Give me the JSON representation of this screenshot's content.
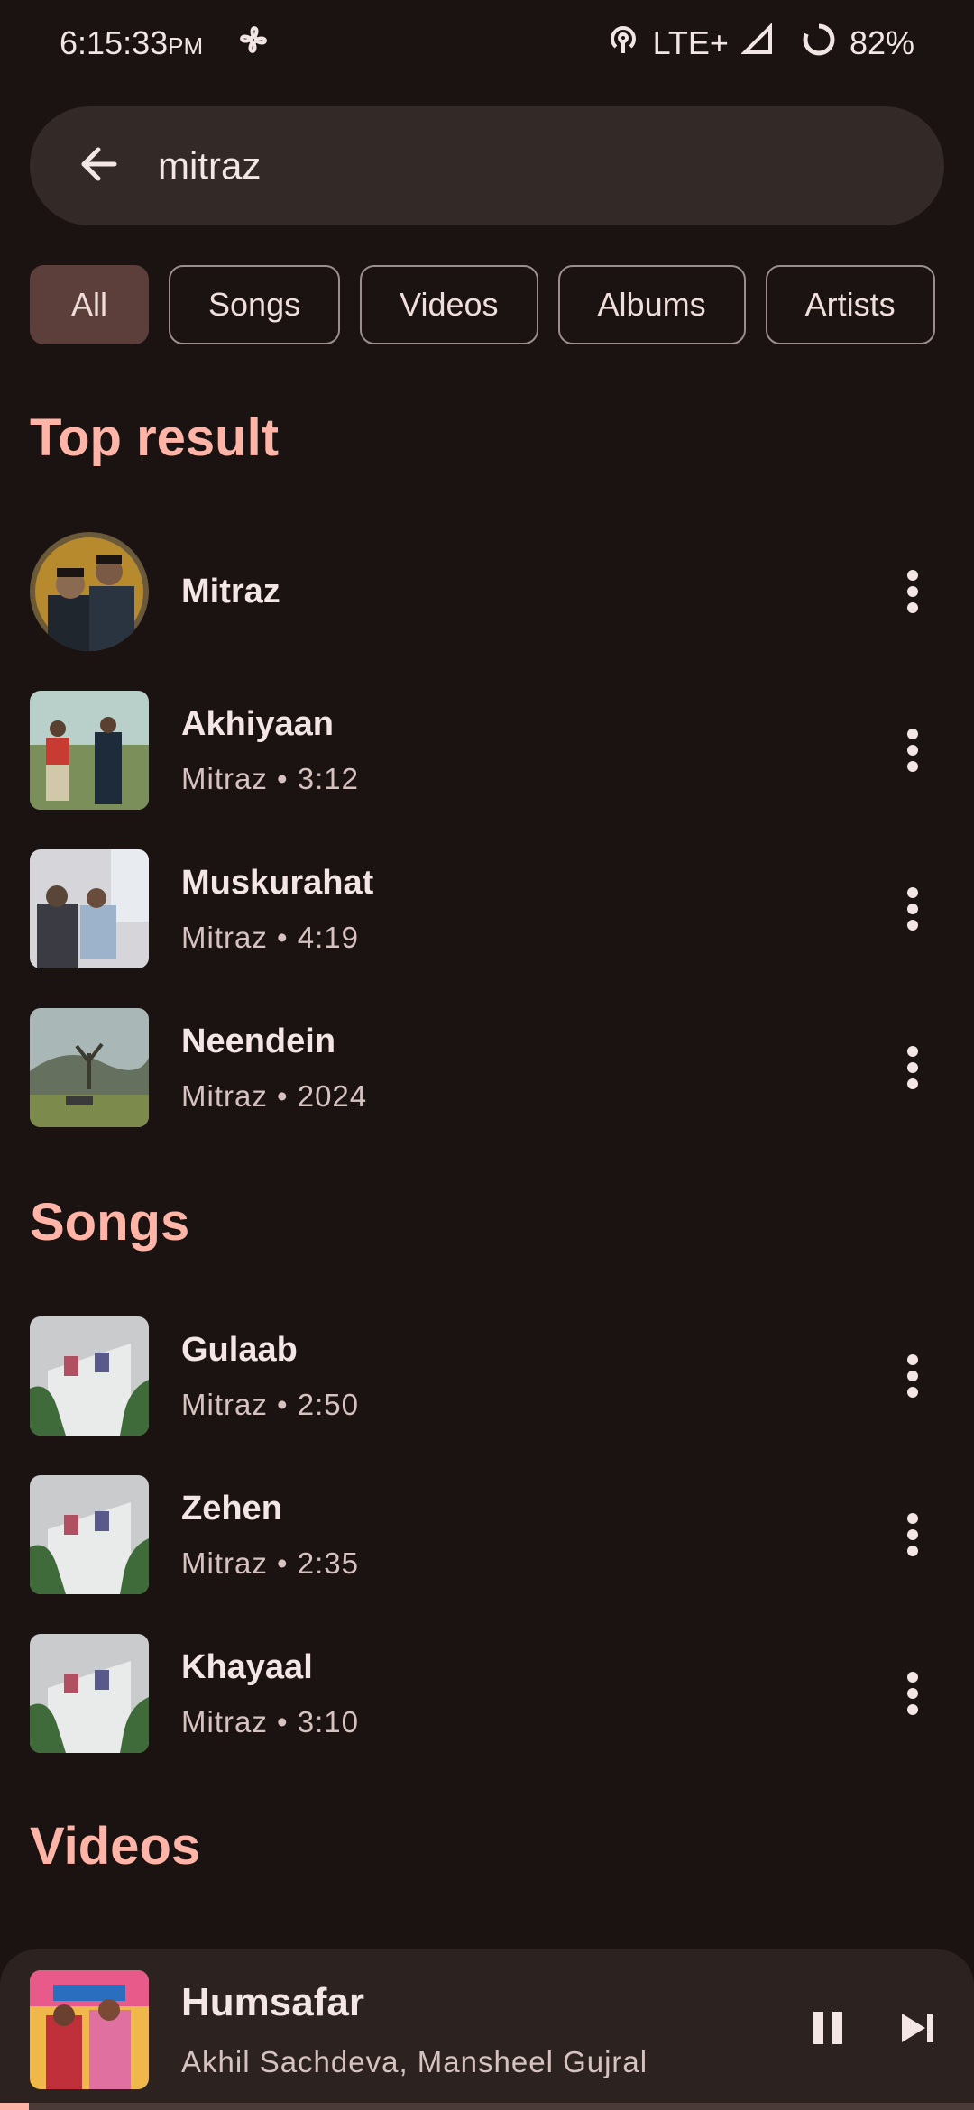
{
  "status_bar": {
    "time": "6:15:33",
    "ampm": "PM",
    "network": "LTE+",
    "battery": "82%"
  },
  "search": {
    "query": "mitraz",
    "back_icon": "arrow-left-icon"
  },
  "chips": [
    {
      "label": "All",
      "active": true
    },
    {
      "label": "Songs",
      "active": false
    },
    {
      "label": "Videos",
      "active": false
    },
    {
      "label": "Albums",
      "active": false
    },
    {
      "label": "Artists",
      "active": false
    }
  ],
  "sections": {
    "top_result": "Top result",
    "songs": "Songs",
    "videos": "Videos"
  },
  "top_results": [
    {
      "title": "Mitraz",
      "subtitle": ""
    },
    {
      "title": "Akhiyaan",
      "subtitle": "Mitraz • 3:12"
    },
    {
      "title": "Muskurahat",
      "subtitle": "Mitraz • 4:19"
    },
    {
      "title": "Neendein",
      "subtitle": "Mitraz • 2024"
    }
  ],
  "songs": [
    {
      "title": "Gulaab",
      "subtitle": "Mitraz • 2:50"
    },
    {
      "title": "Zehen",
      "subtitle": "Mitraz • 2:35"
    },
    {
      "title": "Khayaal",
      "subtitle": "Mitraz • 3:10"
    }
  ],
  "player": {
    "title": "Humsafar",
    "artist": "Akhil Sachdeva, Mansheel Gujral",
    "progress": 0.03
  },
  "colors": {
    "background": "#1b1212",
    "accent": "#ffb4a8",
    "chip_active": "#5c3f3b"
  }
}
